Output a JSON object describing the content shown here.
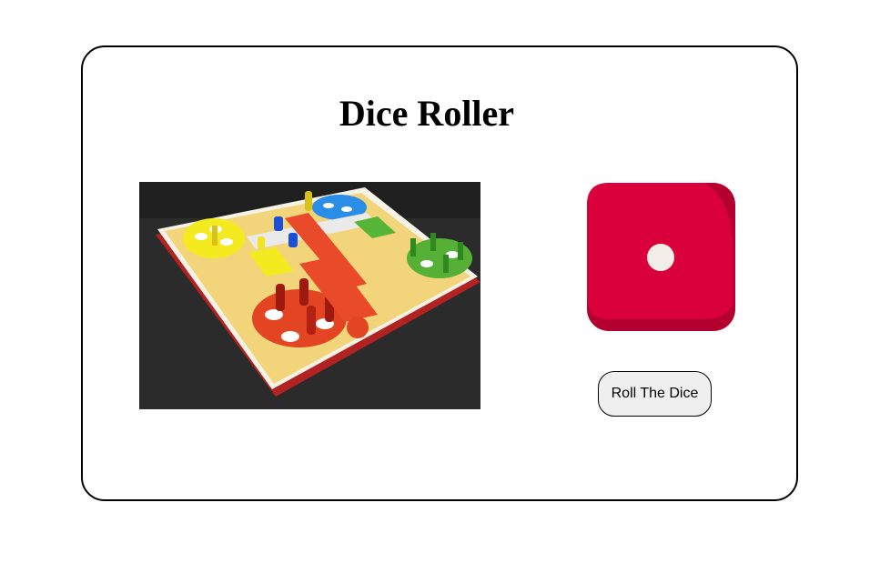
{
  "page": {
    "title": "Dice Roller"
  },
  "board_image": {
    "description": "ludo-board-photo",
    "colors": {
      "background": "#2a2a2a",
      "board": "#f4d27a",
      "yellow": "#f2e51d",
      "blue": "#2a8de8",
      "green": "#52b233",
      "red": "#e8472a"
    }
  },
  "dice": {
    "face_value": 1,
    "colors": {
      "face": "#d9003b",
      "shadow": "#b3002f",
      "pip": "#f3efe8"
    }
  },
  "roll_button": {
    "label": "Roll The Dice"
  }
}
